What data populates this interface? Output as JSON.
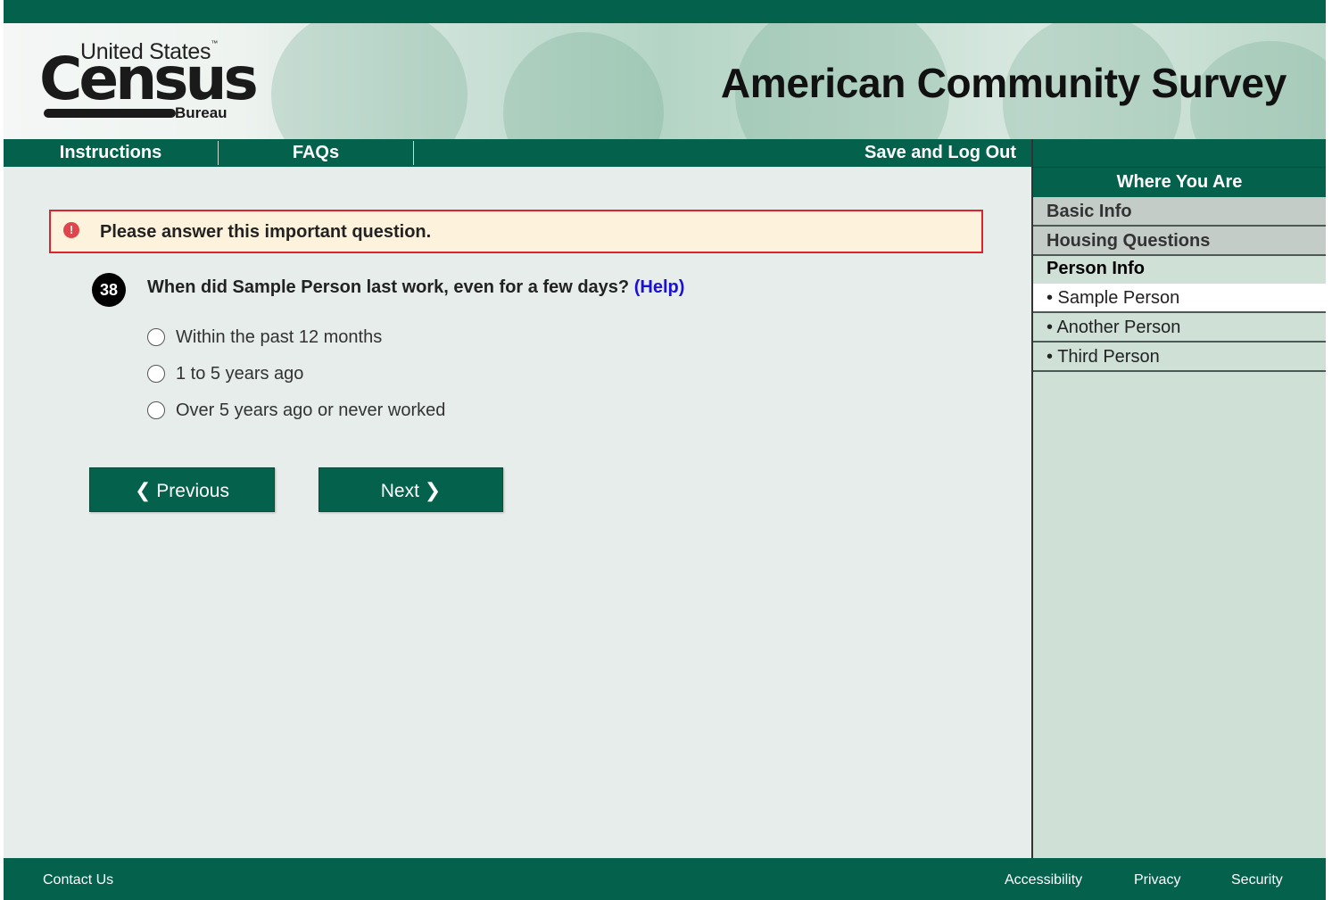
{
  "header": {
    "logo": {
      "top": "United States",
      "name": "Census",
      "sub": "Bureau"
    },
    "title": "American Community Survey"
  },
  "nav": {
    "instructions": "Instructions",
    "faqs": "FAQs",
    "save_logout": "Save and Log Out"
  },
  "sidebar": {
    "heading": "Where You Are",
    "items": [
      {
        "label": "Basic Info",
        "state": "done"
      },
      {
        "label": "Housing Questions",
        "state": "done"
      },
      {
        "label": "Person Info",
        "state": "section"
      },
      {
        "label": "• Sample Person",
        "state": "current"
      },
      {
        "label": "• Another Person",
        "state": "person"
      },
      {
        "label": "• Third Person",
        "state": "person"
      }
    ]
  },
  "alert": {
    "icon": "exclamation-icon",
    "message": "Please answer this important question."
  },
  "question": {
    "number": "38",
    "text": "When did Sample Person last work, even for a few days?",
    "help": "(Help)",
    "options": [
      "Within the past 12 months",
      "1 to 5 years ago",
      "Over 5 years ago or never worked"
    ]
  },
  "buttons": {
    "previous": "Previous",
    "previous_icon": "❮",
    "next": "Next",
    "next_icon": "❯"
  },
  "footer": {
    "contact": "Contact Us",
    "accessibility": "Accessibility",
    "privacy": "Privacy",
    "security": "Security"
  },
  "colors": {
    "brand_green": "#03614c",
    "alert_border": "#e0222b",
    "alert_bg": "#fdf3dc",
    "help_link": "#1a10d8",
    "sidebar_bg": "#cfe0d7"
  }
}
